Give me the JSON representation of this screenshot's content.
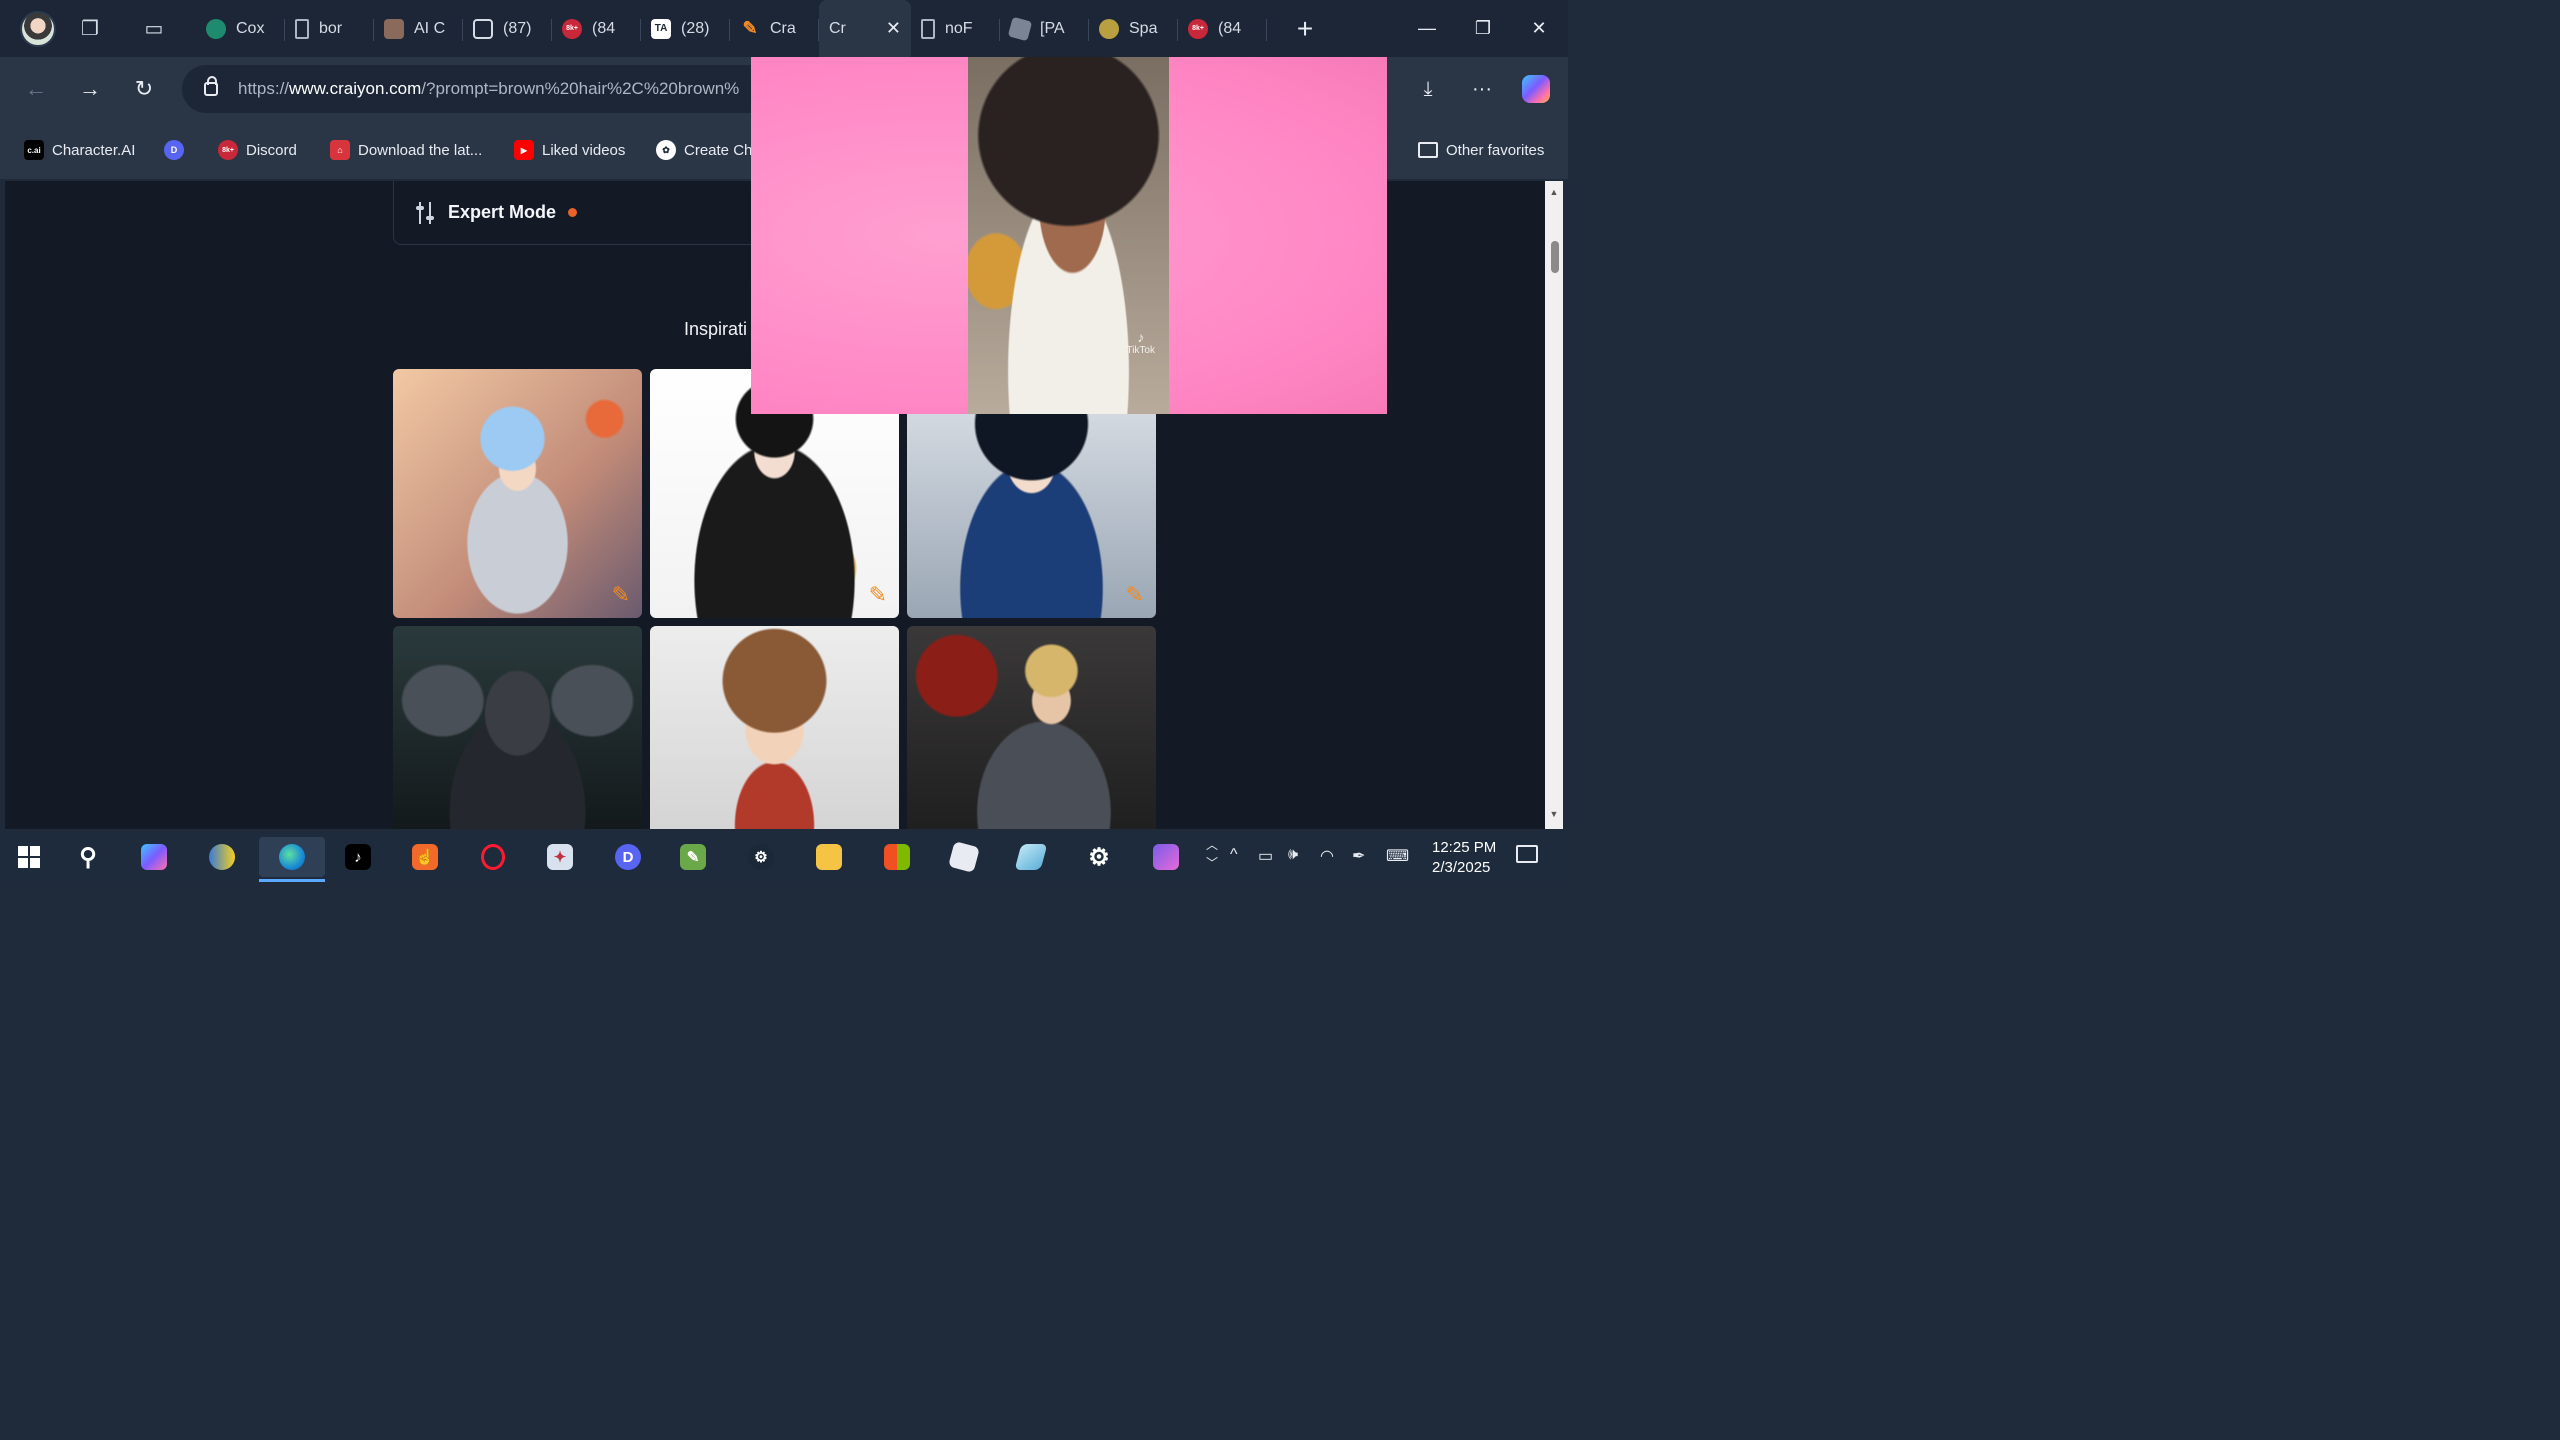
{
  "tabs": [
    {
      "label": "Cox",
      "icon": "globe-icon",
      "color": "#1e8b6e"
    },
    {
      "label": "bor",
      "icon": "document-icon",
      "color": "#5a6578"
    },
    {
      "label": "AI C",
      "icon": "avatar-icon",
      "color": "#8a6a5a"
    },
    {
      "label": "(87)",
      "icon": "media-icon",
      "color": "#3a4659"
    },
    {
      "label": "(84",
      "icon": "badge-8k-icon",
      "color": "#c8283a"
    },
    {
      "label": "(28)",
      "icon": "ta-icon",
      "color": "#ffffff"
    },
    {
      "label": "Cra",
      "icon": "pencil-icon",
      "color": "#f08a24"
    },
    {
      "label": "Cr",
      "icon": "pencil-icon",
      "color": "#f08a24",
      "active": true
    },
    {
      "label": "noF",
      "icon": "document-icon",
      "color": "#5a6578"
    },
    {
      "label": "[PA",
      "icon": "roblox-icon",
      "color": "#7a8494"
    },
    {
      "label": "Spa",
      "icon": "face-icon",
      "color": "#b8a040"
    },
    {
      "label": "(84",
      "icon": "badge-8k-icon",
      "color": "#c8283a"
    }
  ],
  "address": {
    "url_prefix": "https://",
    "url_host": "www.craiyon.com",
    "url_rest": "/?prompt=brown%20hair%2C%20brown%"
  },
  "bookmarks": [
    {
      "label": "Character.AI",
      "icon": "cai-icon",
      "badge": "c.ai"
    },
    {
      "label": "",
      "icon": "discord-icon",
      "badge": "D"
    },
    {
      "label": "Discord",
      "icon": "badge-8k-icon",
      "badge": "8k+"
    },
    {
      "label": "Download the lat...",
      "icon": "store-icon",
      "badge": "⌂"
    },
    {
      "label": "Liked videos",
      "icon": "youtube-icon",
      "badge": "▶"
    },
    {
      "label": "Create Cha",
      "icon": "openai-icon",
      "badge": "✿"
    }
  ],
  "other_favorites": "Other favorites",
  "page": {
    "expert_mode": "Expert Mode",
    "inspiration_heading": "Inspirati"
  },
  "taskbar": {
    "time": "12:25 PM",
    "date": "2/3/2025"
  },
  "pip": {
    "watermark_brand": "TikTok",
    "watermark_icon": "tiktok-icon"
  },
  "colors": {
    "accent_orange": "#e8622a",
    "pip_pink": "#ff8cc8",
    "page_bg": "#131a26",
    "chrome_bg": "#2a3546"
  }
}
